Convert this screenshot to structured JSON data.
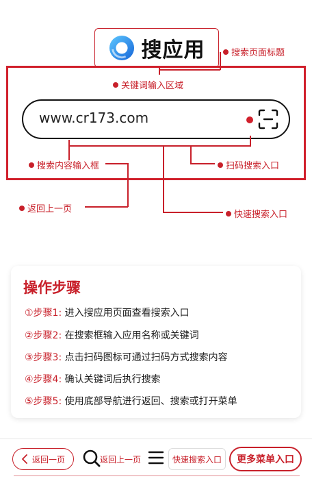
{
  "header": {
    "title": "搜应用",
    "title_annotation": "搜索页面标题"
  },
  "search_region": {
    "annotation": "关键词输入区域",
    "input_value": "www.cr173.com",
    "input_annotation": "搜索内容输入框",
    "scan_annotation": "扫码搜索入口",
    "back_annotation": "返回上一页",
    "quick_annotation": "快速搜索入口"
  },
  "steps": {
    "title": "操作步骤",
    "items": [
      {
        "num": "①步骤1:",
        "text": " 进入搜应用页面查看搜索入口"
      },
      {
        "num": "②步骤2:",
        "text": " 在搜索框输入应用名称或关键词"
      },
      {
        "num": "③步骤3:",
        "text": " 点击扫码图标可通过扫码方式搜索内容"
      },
      {
        "num": "④步骤4:",
        "text": "  确认关键词后执行搜索"
      },
      {
        "num": "⑤步骤5:",
        "text": " 使用底部导航进行返回、搜索或打开菜单"
      }
    ]
  },
  "bottom_nav": {
    "back_label": "返回一页",
    "search_label": "返回上一页",
    "quick_label": "快速搜索入口",
    "more_label": "更多菜单入口"
  },
  "colors": {
    "accent": "#c8202a",
    "logo_blue": "#1e88e5"
  },
  "icons": [
    "app-logo-icon",
    "scan-icon",
    "chevron-left-icon",
    "search-icon",
    "menu-icon"
  ]
}
